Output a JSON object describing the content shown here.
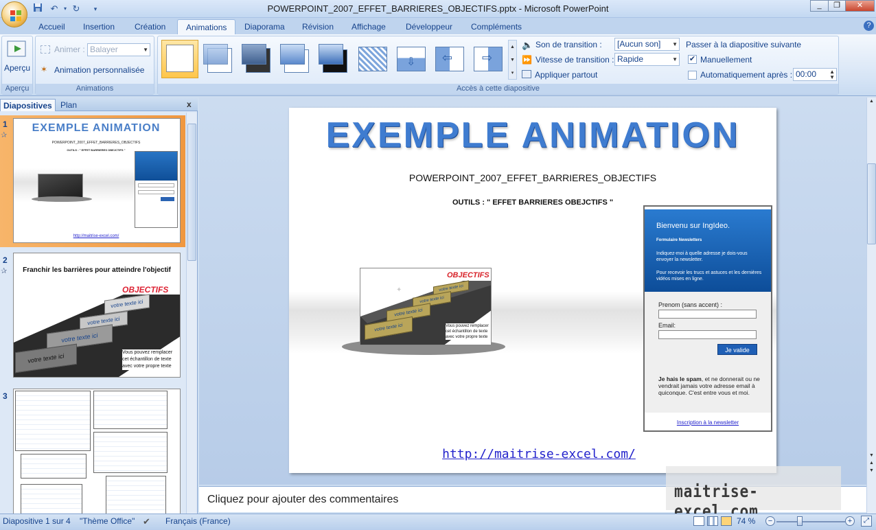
{
  "window": {
    "title": "POWERPOINT_2007_EFFET_BARRIERES_OBJECTIFS.pptx - Microsoft PowerPoint",
    "controls": [
      "_",
      "❐",
      "✕"
    ]
  },
  "tabs": [
    "Accueil",
    "Insertion",
    "Création",
    "Animations",
    "Diaporama",
    "Révision",
    "Affichage",
    "Développeur",
    "Compléments"
  ],
  "active_tab": "Animations",
  "ribbon": {
    "apercu": {
      "button_label": "Aperçu",
      "group_label": "Aperçu"
    },
    "animations": {
      "animer_label": "Animer :",
      "animer_value": "Balayer",
      "custom_label": "Animation personnalisée",
      "group_label": "Animations"
    },
    "transition": {
      "son_label": "Son de transition :",
      "son_value": "[Aucun son]",
      "vitesse_label": "Vitesse de transition :",
      "vitesse_value": "Rapide",
      "appliquer_label": "Appliquer partout",
      "passer_label": "Passer à la diapositive suivante",
      "manuel_label": "Manuellement",
      "manuel_checked": true,
      "auto_label": "Automatiquement après :",
      "auto_checked": false,
      "auto_value": "00:00",
      "group_label": "Accès à cette diapositive"
    }
  },
  "left_pane": {
    "tab_slides": "Diapositives",
    "tab_plan": "Plan",
    "close": "x",
    "slide1": {
      "num": "1",
      "title": "EXEMPLE ANIMATION",
      "subtitle": "POWERPOINT_2007_EFFET_BARRIERES_OBJECTIFS",
      "outils": "OUTILS : \" EFFET BARRIERES OBEJCTIFS \"",
      "link": "http://maitrise-excel.com/"
    },
    "slide2": {
      "num": "2",
      "title": "Franchir les barrières pour atteindre l'objectif",
      "objectifs": "OBJECTIFS",
      "step_text": "votre texte ici",
      "note": "Vous pouvez remplacer cet échantillon de texte avec votre propre texte"
    },
    "slide3": {
      "num": "3"
    }
  },
  "slide": {
    "title": "EXEMPLE ANIMATION",
    "subtitle": "POWERPOINT_2007_EFFET_BARRIERES_OBJECTIFS",
    "outils": "OUTILS : \" EFFET BARRIERES OBEJCTIFS \"",
    "graphic": {
      "objectifs": "OBJECTIFS",
      "step_text": "votre texte ici",
      "note": "Vous pouvez remplacer cet échantillon de texte avec votre propre texte"
    },
    "form": {
      "header": "Bienvenu sur IngIdeo.",
      "newsletter_title": "Formulaire Newsletters",
      "line1": "Indiquez-moi à quelle adresse je dois-vous envoyer la newsletter.",
      "line2": "Pour recevoir les trucs et astuces et les dernières vidéos mises en ligne.",
      "prenom_label": "Prenom (sans accent) :",
      "email_label": "Email:",
      "submit": "Je valide",
      "spam_bold": "Je hais le spam",
      "spam_rest": ", et ne donnerait ou ne vendrait jamais votre adresse email à quiconque. C'est entre vous et moi.",
      "link": "Inscription à la newsletter"
    },
    "link": "http://maitrise-excel.com/"
  },
  "notes_placeholder": "Cliquez pour ajouter des commentaires",
  "watermark": "maitrise-excel.com",
  "status": {
    "slide_info": "Diapositive 1 sur 4",
    "theme": "\"Thème Office\"",
    "language": "Français (France)",
    "zoom": "74 %"
  }
}
